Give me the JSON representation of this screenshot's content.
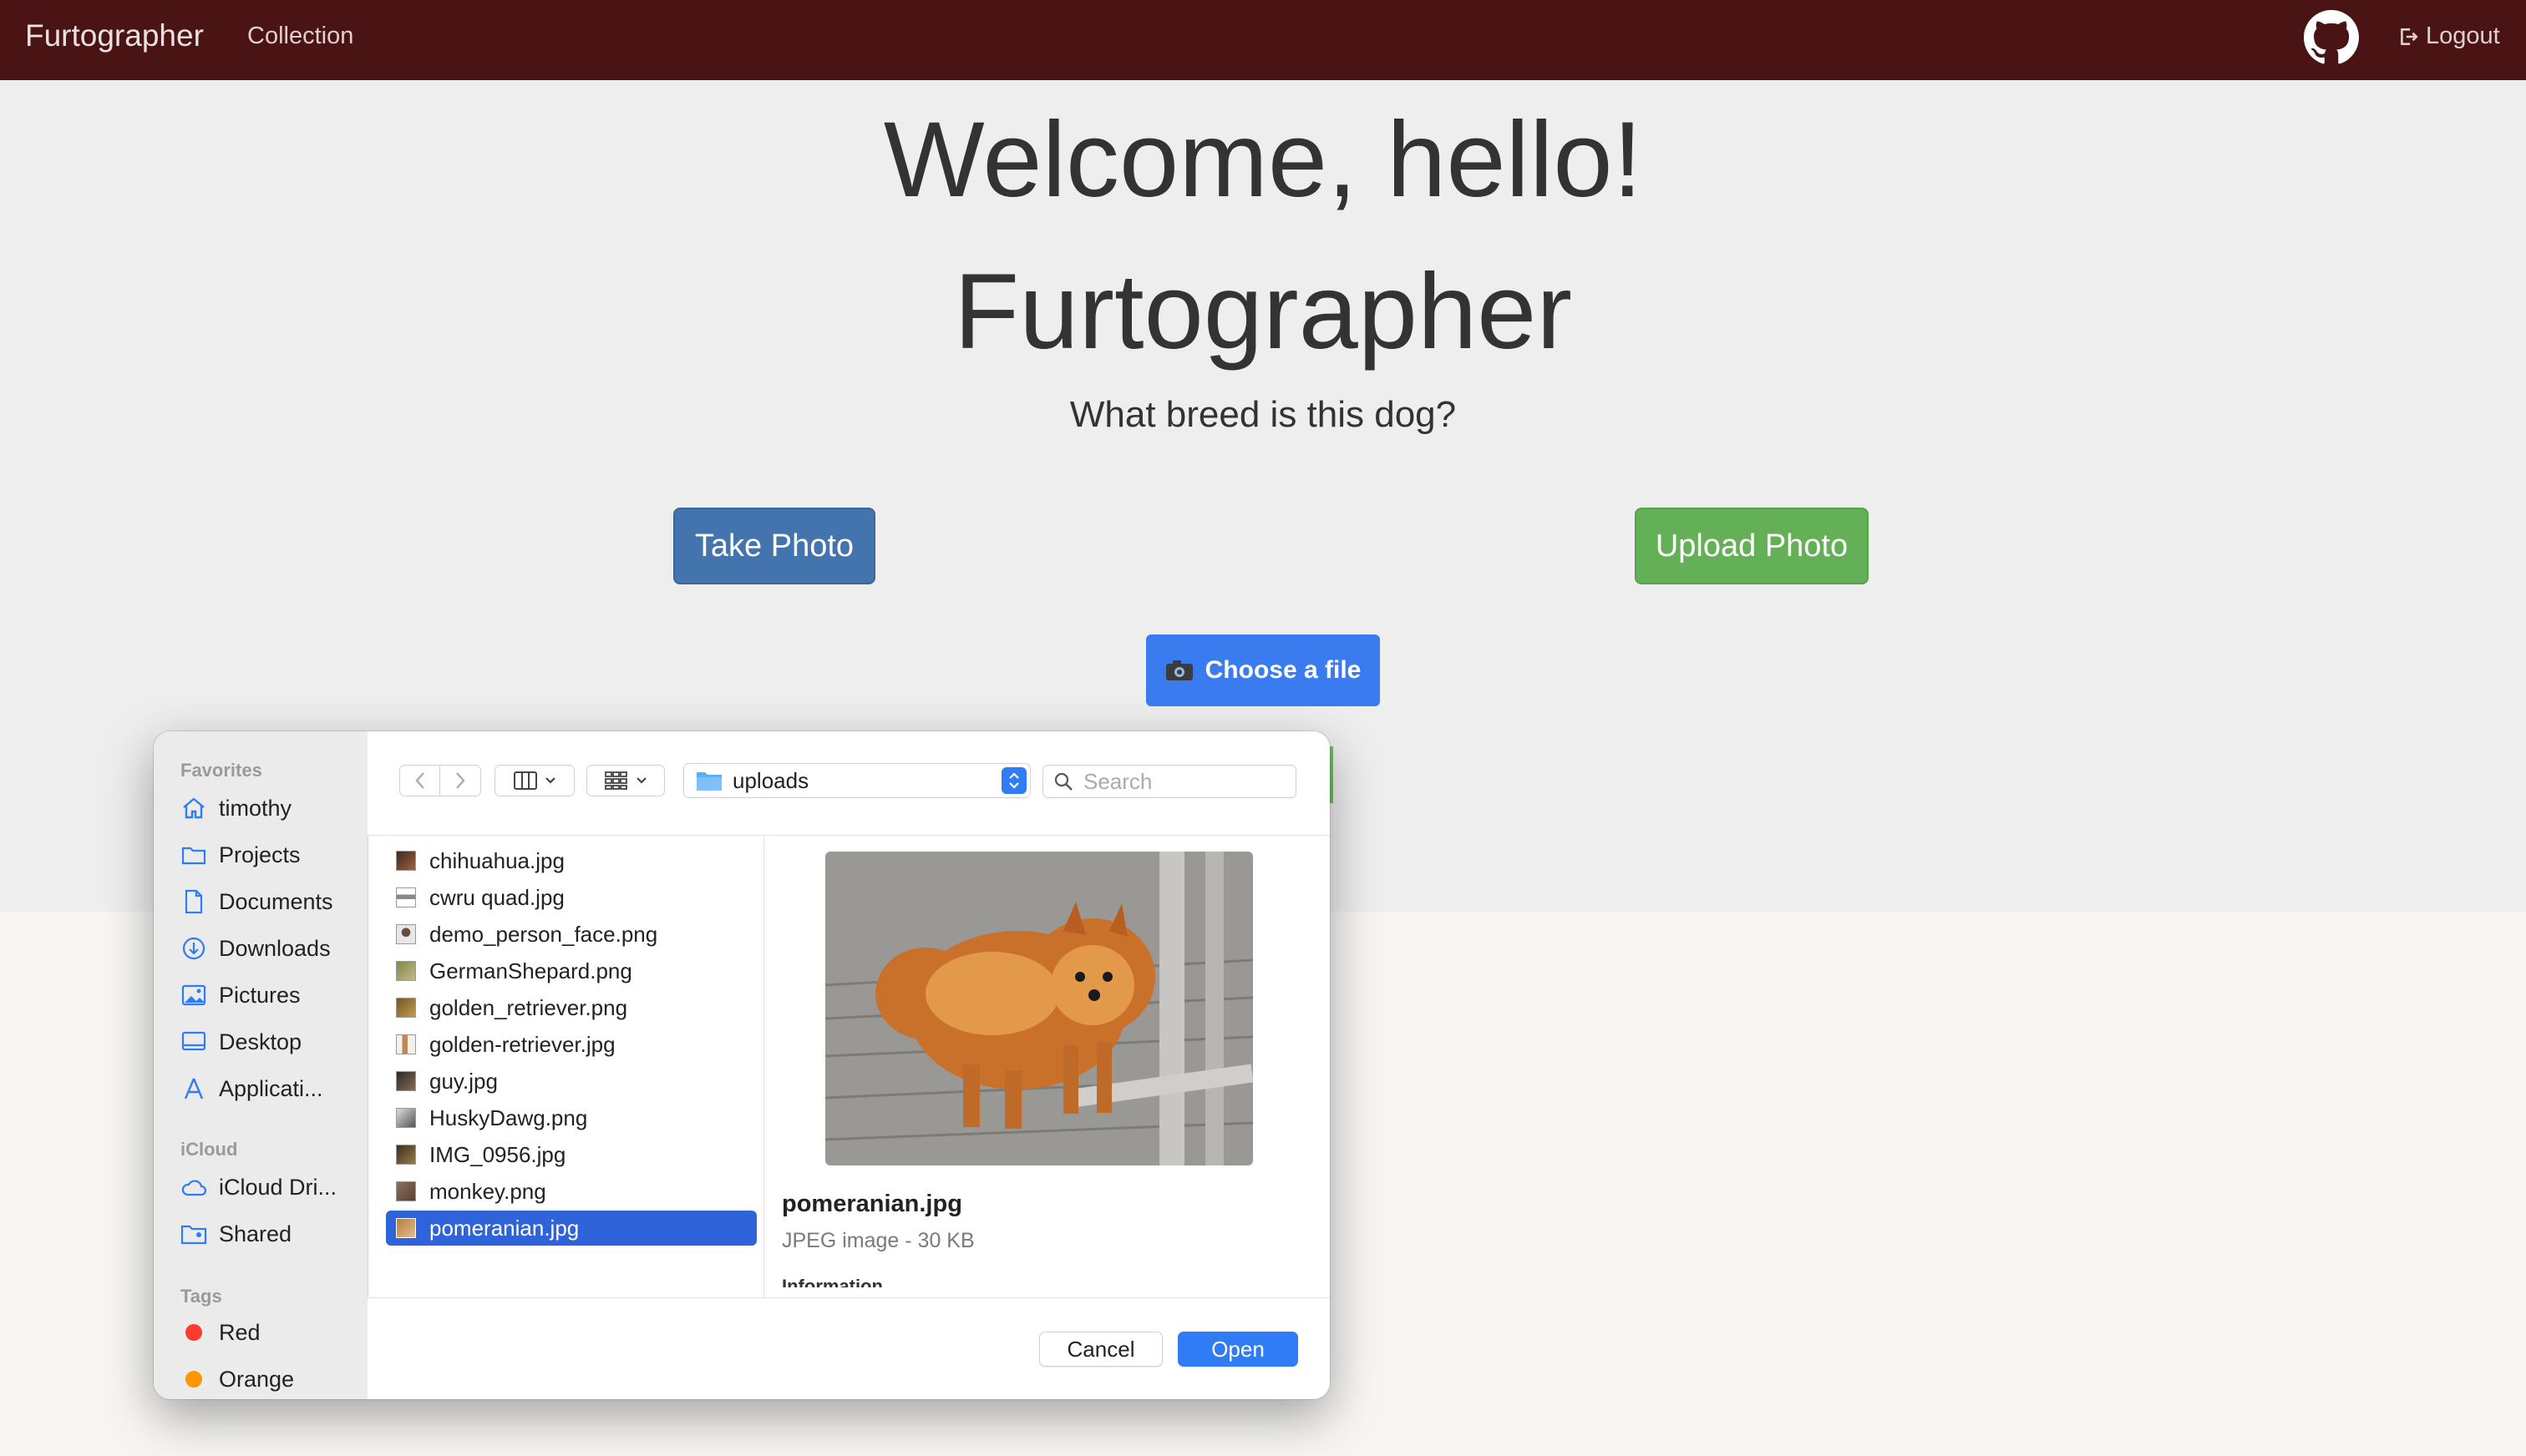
{
  "navbar": {
    "brand": "Furtographer",
    "collection_link": "Collection",
    "github_icon": "github-icon",
    "logout_label": "Logout"
  },
  "hero": {
    "welcome": "Welcome, hello!",
    "app_title": "Furtographer",
    "subtitle": "What breed is this dog?",
    "take_photo": "Take Photo",
    "upload_photo": "Upload Photo",
    "choose_file": "Choose a file"
  },
  "dialog": {
    "sidebar": {
      "favorites_label": "Favorites",
      "favorites": [
        "timothy",
        "Projects",
        "Documents",
        "Downloads",
        "Pictures",
        "Desktop",
        "Applicati..."
      ],
      "icloud_label": "iCloud",
      "icloud": [
        "iCloud Dri...",
        "Shared"
      ],
      "tags_label": "Tags",
      "tags": [
        {
          "name": "Red",
          "color": "#ff3b30"
        },
        {
          "name": "Orange",
          "color": "#ff9500"
        }
      ]
    },
    "toolbar": {
      "folder": "uploads",
      "search_placeholder": "Search"
    },
    "files": [
      "chihuahua.jpg",
      "cwru quad.jpg",
      "demo_person_face.png",
      "GermanShepard.png",
      "golden_retriever.png",
      "golden-retriever.jpg",
      "guy.jpg",
      "HuskyDawg.png",
      "IMG_0956.jpg",
      "monkey.png",
      "pomeranian.jpg"
    ],
    "selected_file": "pomeranian.jpg",
    "preview": {
      "name": "pomeranian.jpg",
      "meta": "JPEG image - 30 KB",
      "info": "Information"
    },
    "buttons": {
      "cancel": "Cancel",
      "open": "Open"
    }
  },
  "colors": {
    "navbar": "#4a1414",
    "take_photo": "#4474ad",
    "upload_photo": "#64b057",
    "choose_file": "#3a7cf0",
    "selection": "#2e63d9"
  }
}
